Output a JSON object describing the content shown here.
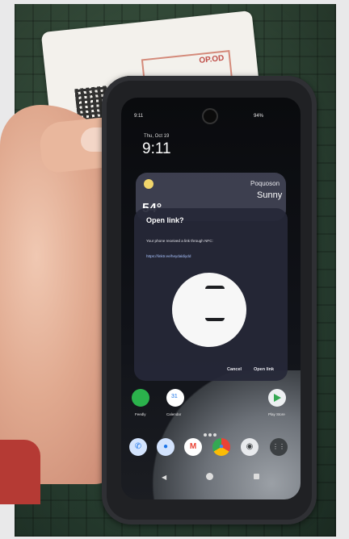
{
  "card": {
    "stamp_text": "OP.OD"
  },
  "status_bar": {
    "time": "9:11",
    "battery": "94%"
  },
  "lockscreen": {
    "date": "Thu, Oct 19",
    "clock": "9:11"
  },
  "weather": {
    "location": "Poquoson",
    "condition": "Sunny",
    "temperature": "54°"
  },
  "nfc_dialog": {
    "title": "Open link?",
    "message": "Your phone received a link through NFC:",
    "link": "https://linktr.ee/heydaldiydd",
    "cancel_label": "Cancel",
    "open_label": "Open link"
  },
  "apps": {
    "feedly": "Feedly",
    "calendar": "Calendar",
    "playstore": "Play Store"
  },
  "icons": [
    "phone-icon",
    "contacts-icon",
    "gmail-icon",
    "chrome-icon",
    "camera-icon",
    "apps-icon",
    "back-icon",
    "home-icon",
    "recents-icon"
  ],
  "colors": {
    "dialog_bg": "#262838",
    "link": "#a9c4ff",
    "feedly": "#2bb24c",
    "weather_sun": "#f1d56b"
  }
}
